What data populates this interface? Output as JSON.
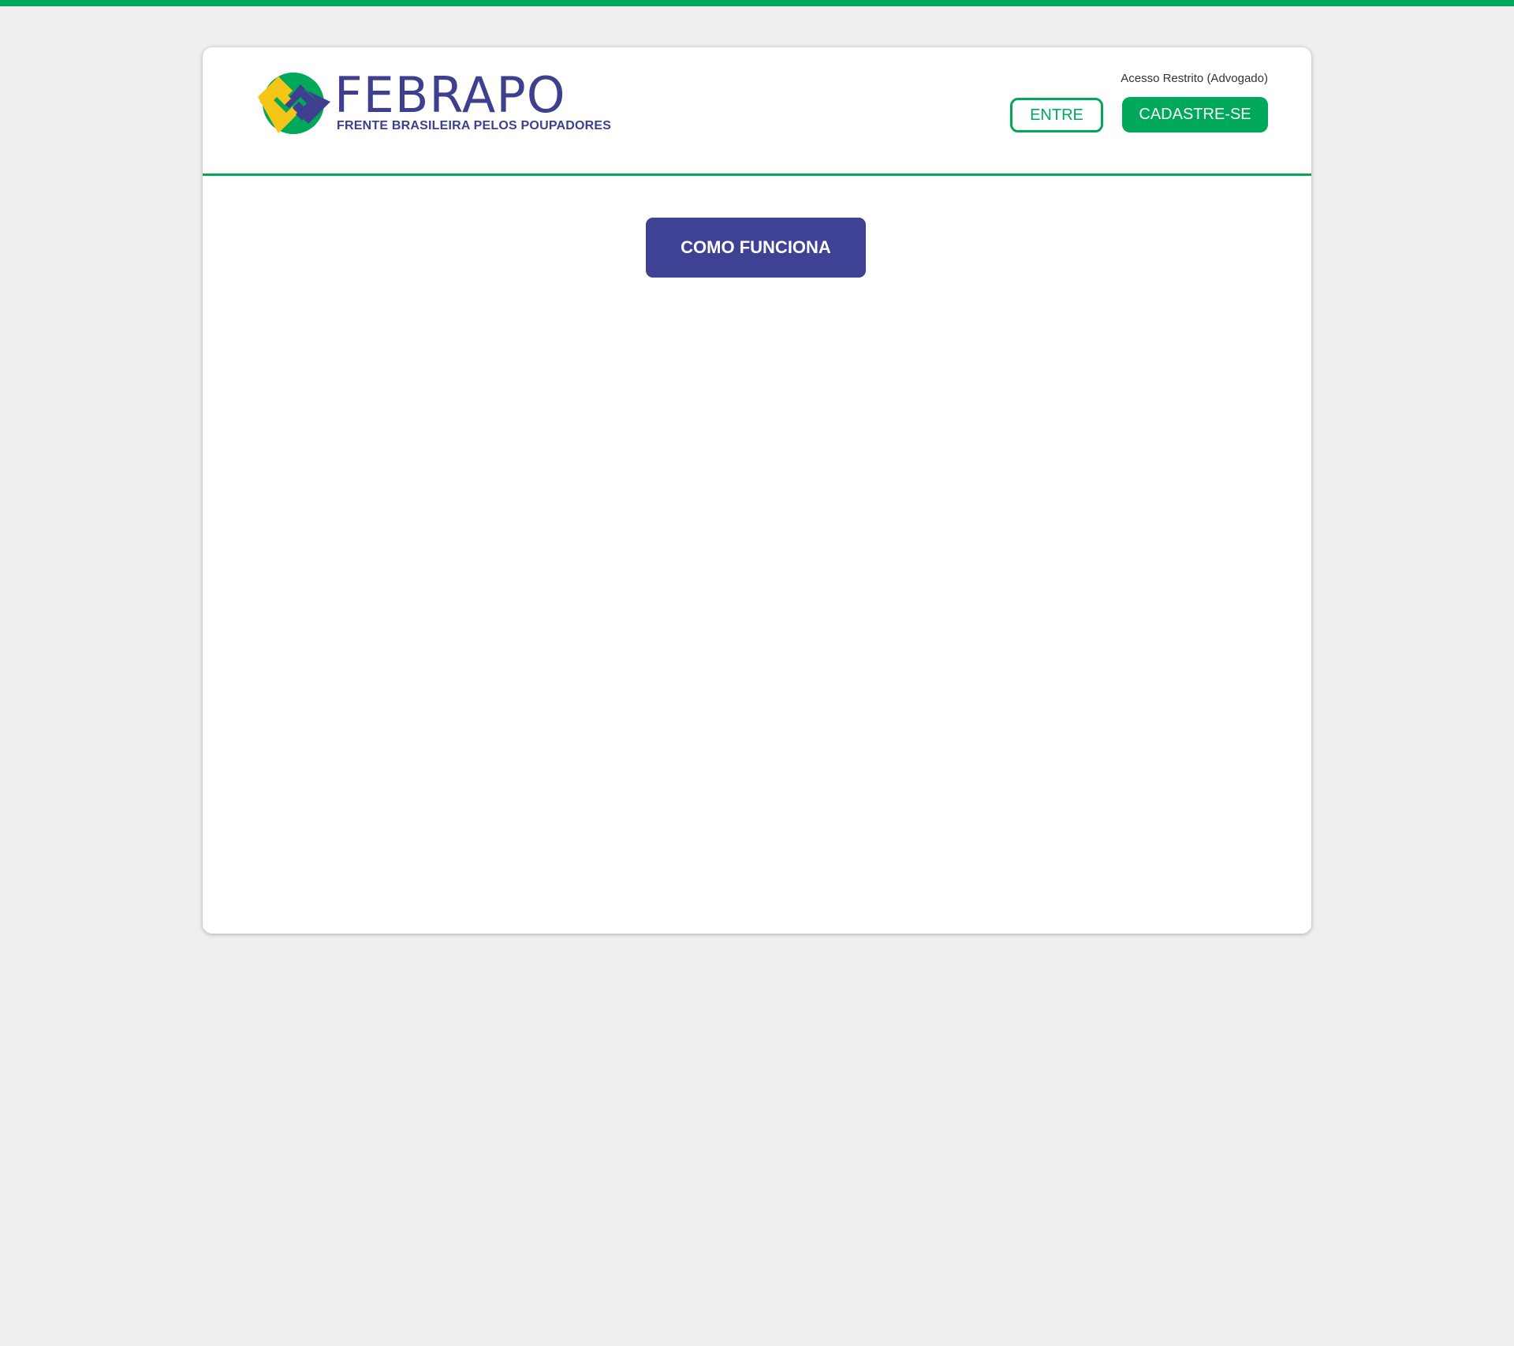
{
  "brand": {
    "name": "FEBRAPO",
    "tagline": "FRENTE BRASILEIRA PELOS POUPADORES",
    "logo_icon": "febrapo-logo-icon"
  },
  "header": {
    "restricted_label": "Acesso Restrito (Advogado)",
    "login_button": "ENTRE",
    "signup_button": "CADASTRE-SE"
  },
  "main": {
    "how_it_works_button": "COMO FUNCIONA"
  },
  "colors": {
    "accent_green": "#00a859",
    "brand_purple": "#3f3f90",
    "brand_yellow": "#f5c518",
    "page_background": "#efefef"
  }
}
